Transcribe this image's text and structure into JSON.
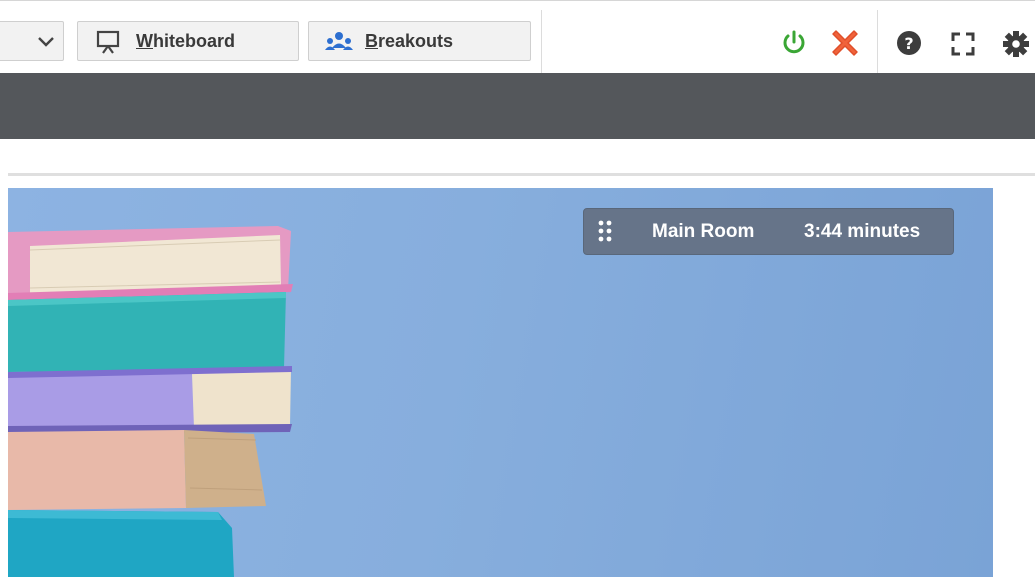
{
  "toolbar": {
    "whiteboard_prefix": "",
    "whiteboard_mnemonic": "W",
    "whiteboard_rest": "hiteboard",
    "breakouts_mnemonic": "B",
    "breakouts_rest": "reakouts"
  },
  "room": {
    "name": "Main Room",
    "timer": "3:44 minutes"
  },
  "colors": {
    "power_green": "#3aa635",
    "close_red": "#f0633b",
    "header_dark": "#54575b",
    "breakouts_blue": "#2d6fd0"
  }
}
